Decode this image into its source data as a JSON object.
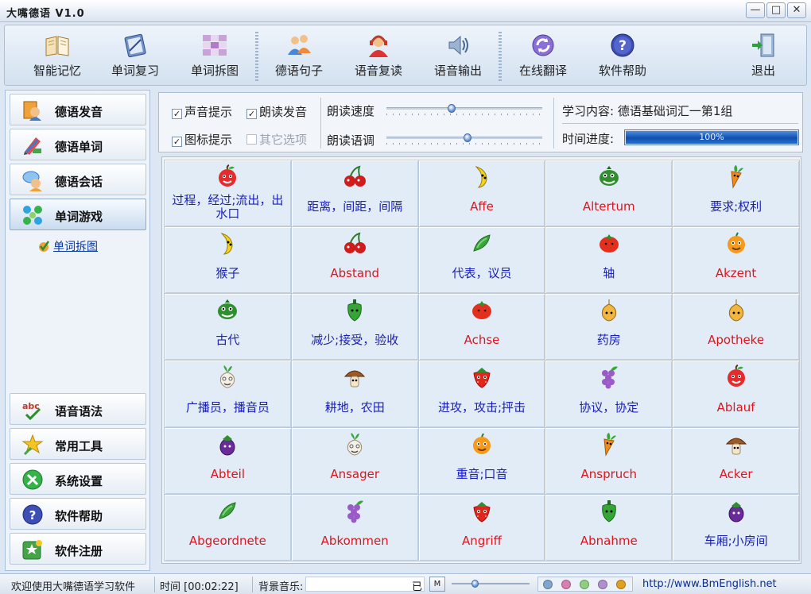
{
  "window": {
    "title": "大嘴德语 V1.0",
    "min": "—",
    "max": "□",
    "close": "✕"
  },
  "toolbar": [
    {
      "id": "memory",
      "label": "智能记忆",
      "icon": "book-icon"
    },
    {
      "id": "review",
      "label": "单词复习",
      "icon": "notebook-icon"
    },
    {
      "id": "puzzle",
      "label": "单词拆图",
      "icon": "puzzle-grid-icon"
    },
    {
      "id": "sentence",
      "label": "德语句子",
      "icon": "people-icon"
    },
    {
      "id": "repeat",
      "label": "语音复读",
      "icon": "headset-person-icon"
    },
    {
      "id": "output",
      "label": "语音输出",
      "icon": "speaker-icon"
    },
    {
      "id": "translate",
      "label": "在线翻译",
      "icon": "refresh-globe-icon"
    },
    {
      "id": "help",
      "label": "软件帮助",
      "icon": "help-icon"
    },
    {
      "id": "exit",
      "label": "退出",
      "icon": "exit-door-icon"
    }
  ],
  "nav": {
    "top": [
      {
        "label": "德语发音",
        "icon": "pronunciation-book-icon",
        "active": false
      },
      {
        "label": "德语单词",
        "icon": "pencil-words-icon",
        "active": false
      },
      {
        "label": "德语会话",
        "icon": "chat-people-icon",
        "active": false
      },
      {
        "label": "单词游戏",
        "icon": "game-dots-icon",
        "active": true
      }
    ],
    "sub_item": "单词拆图",
    "bottom": [
      {
        "label": "语音语法",
        "icon": "abc-icon"
      },
      {
        "label": "常用工具",
        "icon": "tools-star-icon"
      },
      {
        "label": "系统设置",
        "icon": "settings-wrench-icon"
      },
      {
        "label": "软件帮助",
        "icon": "help-icon"
      },
      {
        "label": "软件注册",
        "icon": "register-star-icon"
      }
    ]
  },
  "options": {
    "sound_hint": {
      "label": "声音提示",
      "checked": true
    },
    "read_aloud": {
      "label": "朗读发音",
      "checked": true
    },
    "icon_hint": {
      "label": "图标提示",
      "checked": true
    },
    "other": {
      "label": "其它选项",
      "checked": false,
      "disabled": true
    },
    "speed_label": "朗读速度",
    "speed_value": 0.42,
    "tone_label": "朗读语调",
    "tone_value": 0.52,
    "content_label": "学习内容:",
    "content_value": "德语基础词汇一第1组",
    "time_label": "时间进度:",
    "progress": 100,
    "progress_text": "100%"
  },
  "cells": [
    {
      "text": "过程，经过;流出，出水口",
      "lang": "zh",
      "icon": "apple-icon"
    },
    {
      "text": "距离，间距，间隔",
      "lang": "zh",
      "icon": "cherry-icon"
    },
    {
      "text": "Affe",
      "lang": "de",
      "icon": "banana-icon"
    },
    {
      "text": "Altertum",
      "lang": "de",
      "icon": "pepper-green-face-icon"
    },
    {
      "text": "要求;权利",
      "lang": "zh",
      "icon": "carrot-icon"
    },
    {
      "text": "猴子",
      "lang": "zh",
      "icon": "banana-icon"
    },
    {
      "text": "Abstand",
      "lang": "de",
      "icon": "cherry-icon"
    },
    {
      "text": "代表，议员",
      "lang": "zh",
      "icon": "cucumber-icon"
    },
    {
      "text": "轴",
      "lang": "zh",
      "icon": "tomato-icon"
    },
    {
      "text": "Akzent",
      "lang": "de",
      "icon": "orange-icon"
    },
    {
      "text": "古代",
      "lang": "zh",
      "icon": "pepper-green-face-icon"
    },
    {
      "text": "减少;接受，验收",
      "lang": "zh",
      "icon": "green-pepper-icon"
    },
    {
      "text": "Achse",
      "lang": "de",
      "icon": "tomato-icon"
    },
    {
      "text": "药房",
      "lang": "zh",
      "icon": "onion-icon"
    },
    {
      "text": "Apotheke",
      "lang": "de",
      "icon": "onion-icon"
    },
    {
      "text": "广播员，播音员",
      "lang": "zh",
      "icon": "turnip-icon"
    },
    {
      "text": "耕地，农田",
      "lang": "zh",
      "icon": "mushroom-icon"
    },
    {
      "text": "进攻，攻击;抨击",
      "lang": "zh",
      "icon": "strawberry-icon"
    },
    {
      "text": "协议，协定",
      "lang": "zh",
      "icon": "grapes-icon"
    },
    {
      "text": "Ablauf",
      "lang": "de",
      "icon": "apple-icon"
    },
    {
      "text": "Abteil",
      "lang": "de",
      "icon": "eggplant-icon"
    },
    {
      "text": "Ansager",
      "lang": "de",
      "icon": "turnip-icon"
    },
    {
      "text": "重音;口音",
      "lang": "zh",
      "icon": "orange-icon"
    },
    {
      "text": "Anspruch",
      "lang": "de",
      "icon": "carrot-icon"
    },
    {
      "text": "Acker",
      "lang": "de",
      "icon": "mushroom-icon"
    },
    {
      "text": "Abgeordnete",
      "lang": "de",
      "icon": "cucumber-icon"
    },
    {
      "text": "Abkommen",
      "lang": "de",
      "icon": "grapes-icon"
    },
    {
      "text": "Angriff",
      "lang": "de",
      "icon": "strawberry-icon"
    },
    {
      "text": "Abnahme",
      "lang": "de",
      "icon": "green-pepper-icon"
    },
    {
      "text": "车厢;小房间",
      "lang": "zh",
      "icon": "eggplant-icon"
    }
  ],
  "status": {
    "welcome": "欢迎使用大嘴德语学习软件",
    "time_label": "时间",
    "time_value": "[00:02:22]",
    "music_label": "背景音乐:",
    "music_value": "已",
    "music_button": "M",
    "volume": 0.3,
    "url": "http://www.BmEnglish.net",
    "dot_colors": [
      "#7fa6cc",
      "#d77fb0",
      "#8fcf7f",
      "#b08fd0",
      "#e0a020"
    ]
  },
  "colors": {
    "chinese_text": "#1a20b8",
    "german_text": "#e0141e"
  }
}
